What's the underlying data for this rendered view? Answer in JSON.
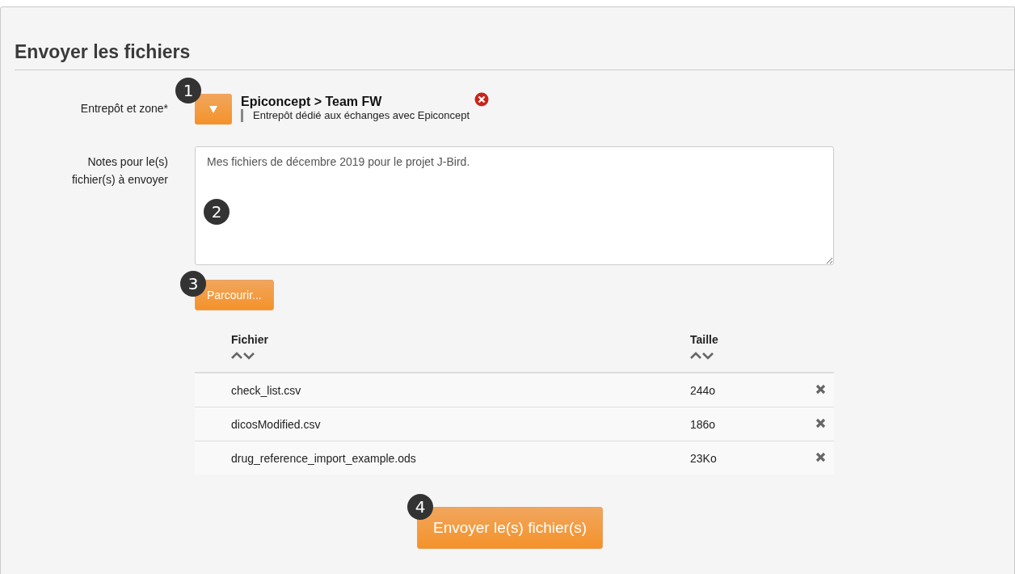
{
  "title": "Envoyer les fichiers",
  "warehouse": {
    "label": "Entrepôt et zone*",
    "badge": "1",
    "name": "Epiconcept > Team FW",
    "description": "Entrepôt dédié aux échanges avec Epiconcept"
  },
  "notes": {
    "label": "Notes pour le(s) fichier(s) à envoyer",
    "badge": "2",
    "value": "Mes fichiers de décembre 2019 pour le projet J-Bird."
  },
  "browse": {
    "badge": "3",
    "label": "Parcourir..."
  },
  "table": {
    "columns": [
      "Fichier",
      "Taille"
    ],
    "rows": [
      {
        "file": "check_list.csv",
        "size": "244o"
      },
      {
        "file": "dicosModified.csv",
        "size": "186o"
      },
      {
        "file": "drug_reference_import_example.ods",
        "size": "23Ko"
      }
    ]
  },
  "submit": {
    "badge": "4",
    "label": "Envoyer le(s) fichier(s)"
  }
}
